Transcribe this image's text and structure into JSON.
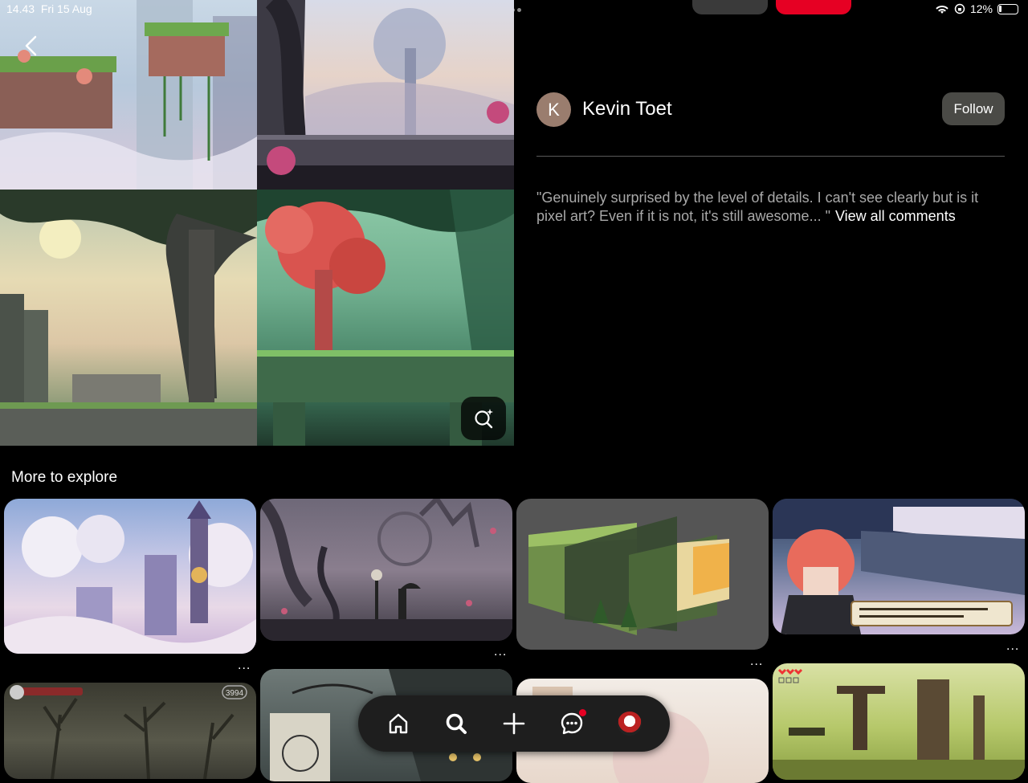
{
  "status_bar": {
    "time": "14.43",
    "date": "Fri 15 Aug",
    "battery": "12%"
  },
  "pin": {
    "author_initial": "K",
    "author_name": "Kevin Toet",
    "follow_label": "Follow",
    "comment_text": "\"Genuinely surprised by the level of details. I can't see clearly but is it pixel art? Even if it is not, it's still awesome... \"",
    "view_all_label": "View all comments"
  },
  "explore": {
    "title": "More to explore",
    "more_label": "..."
  },
  "game_ui": {
    "score": "3994"
  },
  "nav": {
    "items": [
      "home-icon",
      "search-icon",
      "plus-icon",
      "messages-icon",
      "profile-avatar"
    ]
  },
  "colors": {
    "accent": "#e60023",
    "follow_bg": "#4a4a46",
    "nav_bg": "#1e1e1e"
  }
}
